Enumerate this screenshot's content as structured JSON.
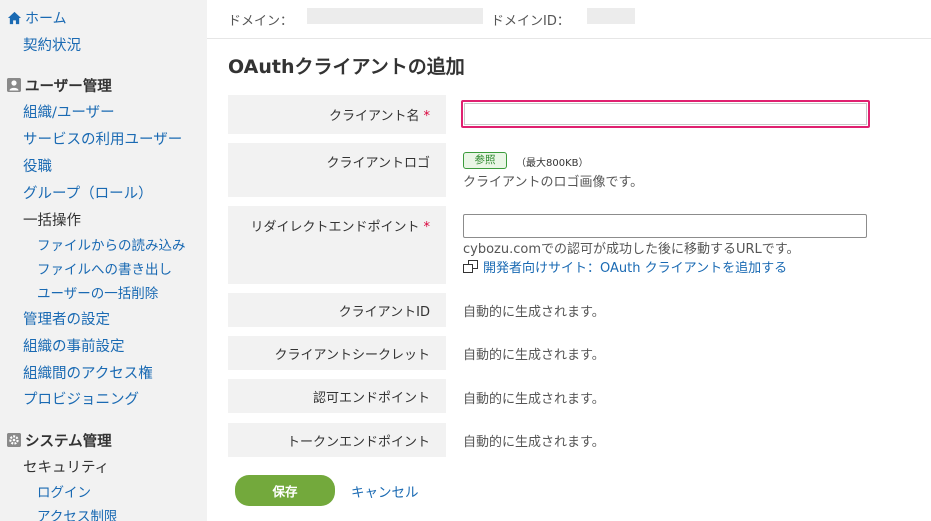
{
  "sidebar": {
    "home": "ホーム",
    "contract": "契約状況",
    "user_mgmt": {
      "heading": "ユーザー管理",
      "items": [
        "組織/ユーザー",
        "サービスの利用ユーザー",
        "役職",
        "グループ（ロール）"
      ],
      "bulk": {
        "heading": "一括操作",
        "items": [
          "ファイルからの読み込み",
          "ファイルへの書き出し",
          "ユーザーの一括削除"
        ]
      },
      "items2": [
        "管理者の設定",
        "組織の事前設定",
        "組織間のアクセス権",
        "プロビジョニング"
      ]
    },
    "system_mgmt": {
      "heading": "システム管理",
      "security": "セキュリティ",
      "items": [
        "ログイン",
        "アクセス制限"
      ]
    }
  },
  "header": {
    "domain_label": "ドメイン：",
    "domain_id_label": "ドメインID："
  },
  "page_title": "OAuthクライアントの追加",
  "form": {
    "client_name": {
      "label": "クライアント名",
      "required_mark": "*",
      "value": ""
    },
    "client_logo": {
      "label": "クライアントロゴ",
      "button": "参照",
      "max_size": "（最大800KB）",
      "description": "クライアントのロゴ画像です。"
    },
    "redirect_endpoint": {
      "label": "リダイレクトエンドポイント",
      "required_mark": "*",
      "value": "",
      "description": "cybozu.comでの認可が成功した後に移動するURLです。",
      "dev_link": "開発者向けサイト：OAuth クライアントを追加する"
    },
    "client_id": {
      "label": "クライアントID",
      "value": "自動的に生成されます。"
    },
    "client_secret": {
      "label": "クライアントシークレット",
      "value": "自動的に生成されます。"
    },
    "auth_endpoint": {
      "label": "認可エンドポイント",
      "value": "自動的に生成されます。"
    },
    "token_endpoint": {
      "label": "トークンエンドポイント",
      "value": "自動的に生成されます。"
    }
  },
  "actions": {
    "save": "保存",
    "cancel": "キャンセル"
  },
  "colors": {
    "link": "#1a6ab3",
    "required": "#d9003a",
    "focus_border": "#e02070",
    "save_button": "#73a93c"
  }
}
